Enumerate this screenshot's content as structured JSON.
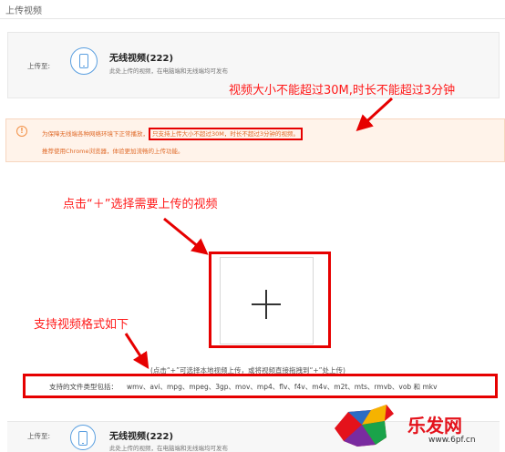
{
  "header": {
    "title": "上传视频"
  },
  "upload_target": {
    "label": "上传至:",
    "name": "无线视频(222)",
    "description": "此处上传的视频，在电脑端和无线端均可发布"
  },
  "annotations": {
    "size_limit": "视频大小不能超过30M,时长不能超过3分钟",
    "click_plus": "点击“＋”选择需要上传的视频",
    "formats": "支持视频格式如下"
  },
  "notice": {
    "icon": "!",
    "text_prefix": "为保障无线端各种网络环境下正常播放，",
    "text_highlight": "只支持上传大小不超过30M，时长不超过3分钟的视频。",
    "browser_tip": "推荐使用Chrome浏览器，体验更加流畅的上传功能。"
  },
  "upload_area": {
    "hint": "(点击“+”可选择本地视频上传，或将视频直接拖拽到“+”处上传)",
    "formats_label": "支持的文件类型包括：",
    "formats": "wmv、avi、mpg、mpeg、3gp、mov、mp4、flv、f4v、m4v、m2t、mts、rmvb、vob 和 mkv"
  },
  "bottom_target": {
    "label": "上传至:",
    "name": "无线视频(222)",
    "description": "此处上传的视频，在电脑端和无线端均可发布"
  },
  "watermark": {
    "logo": "乐发网",
    "url": "www.6pf.cn"
  },
  "colors": {
    "annotation_red": "#e60000",
    "accent_blue": "#5a9fe0",
    "notice_orange": "#f29249"
  }
}
